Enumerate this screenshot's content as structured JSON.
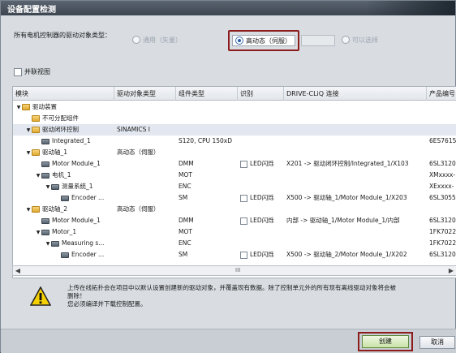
{
  "window": {
    "title": "设备配置检测"
  },
  "options": {
    "label": "所有电机控制器的驱动对象类型：",
    "radio_general": "通用（矢量）",
    "radio_high": "高动态（伺服）",
    "radio_select": "可以选择"
  },
  "parallel_view": {
    "label": "并联视图"
  },
  "table": {
    "headers": [
      "模块",
      "驱动对象类型",
      "组件类型",
      "识别",
      "DRIVE-CLiQ 连接",
      "产品编号"
    ],
    "rows": [
      {
        "name": "驱动装置",
        "level": 0,
        "toggle": "▼",
        "icon": "folder-icon"
      },
      {
        "name": "不可分配组件",
        "level": 1,
        "toggle": "",
        "icon": "folder-icon"
      },
      {
        "name": "驱动闭环控制",
        "level": 1,
        "toggle": "▼",
        "icon": "folder-icon",
        "drive_type": "SINAMICS I",
        "selected": true
      },
      {
        "name": "Integrated_1",
        "level": 2,
        "toggle": "",
        "icon": "device-icon",
        "comp": "S120, CPU 150xD",
        "part": "6ES7615"
      },
      {
        "name": "驱动轴_1",
        "level": 1,
        "toggle": "▼",
        "icon": "folder-icon",
        "drive_type": "高动态（伺服）"
      },
      {
        "name": "Motor Module_1",
        "level": 2,
        "toggle": "",
        "icon": "device-icon",
        "comp": "DMM",
        "ident": "LED闪烁",
        "conn": "X201 -> 驱动闭环控制/Integrated_1/X103",
        "part": "6SL3120"
      },
      {
        "name": "电机_1",
        "level": 2,
        "toggle": "▼",
        "icon": "device-icon",
        "comp": "MOT",
        "part": "XMxxxx-"
      },
      {
        "name": "测量系统_1",
        "level": 3,
        "toggle": "▼",
        "icon": "device-icon",
        "comp": "ENC",
        "part": "XExxxx-"
      },
      {
        "name": "Encoder ...",
        "level": 4,
        "toggle": "",
        "icon": "device-icon",
        "comp": "SM",
        "ident": "LED闪烁",
        "conn": "X500 -> 驱动轴_1/Motor Module_1/X203",
        "part": "6SL3055"
      },
      {
        "name": "驱动轴_2",
        "level": 1,
        "toggle": "▼",
        "icon": "folder-icon",
        "drive_type": "高动态（伺服）"
      },
      {
        "name": "Motor Module_1",
        "level": 2,
        "toggle": "",
        "icon": "device-icon",
        "comp": "DMM",
        "ident": "LED闪烁",
        "conn": "内部 -> 驱动轴_1/Motor Module_1/内部",
        "part": "6SL3120"
      },
      {
        "name": "Motor_1",
        "level": 2,
        "toggle": "▼",
        "icon": "device-icon",
        "comp": "MOT",
        "part": "1FK7022"
      },
      {
        "name": "Measuring s...",
        "level": 3,
        "toggle": "▼",
        "icon": "device-icon",
        "comp": "ENC",
        "part": "1FK7022"
      },
      {
        "name": "Encoder ...",
        "level": 4,
        "toggle": "",
        "icon": "device-icon",
        "comp": "SM",
        "ident": "LED闪烁",
        "conn": "X500 -> 驱动轴_2/Motor Module_1/X202",
        "part": "6SL3120"
      }
    ]
  },
  "scroll": {
    "grip": "III"
  },
  "message": {
    "line1": "上传在线拓扑会在项目中以默认设置创建新的驱动对象，并覆盖现有数据。除了控制单元外的所有现有离线驱动对象将会被",
    "line2": "删除！",
    "line3": "您必须编译并下载控制配置。"
  },
  "buttons": {
    "create": "创建",
    "cancel": "取消"
  },
  "colors": {
    "highlight": "#8c1c1c",
    "title_bar": "#4a535d",
    "selected_row": "#e2e7f0"
  }
}
